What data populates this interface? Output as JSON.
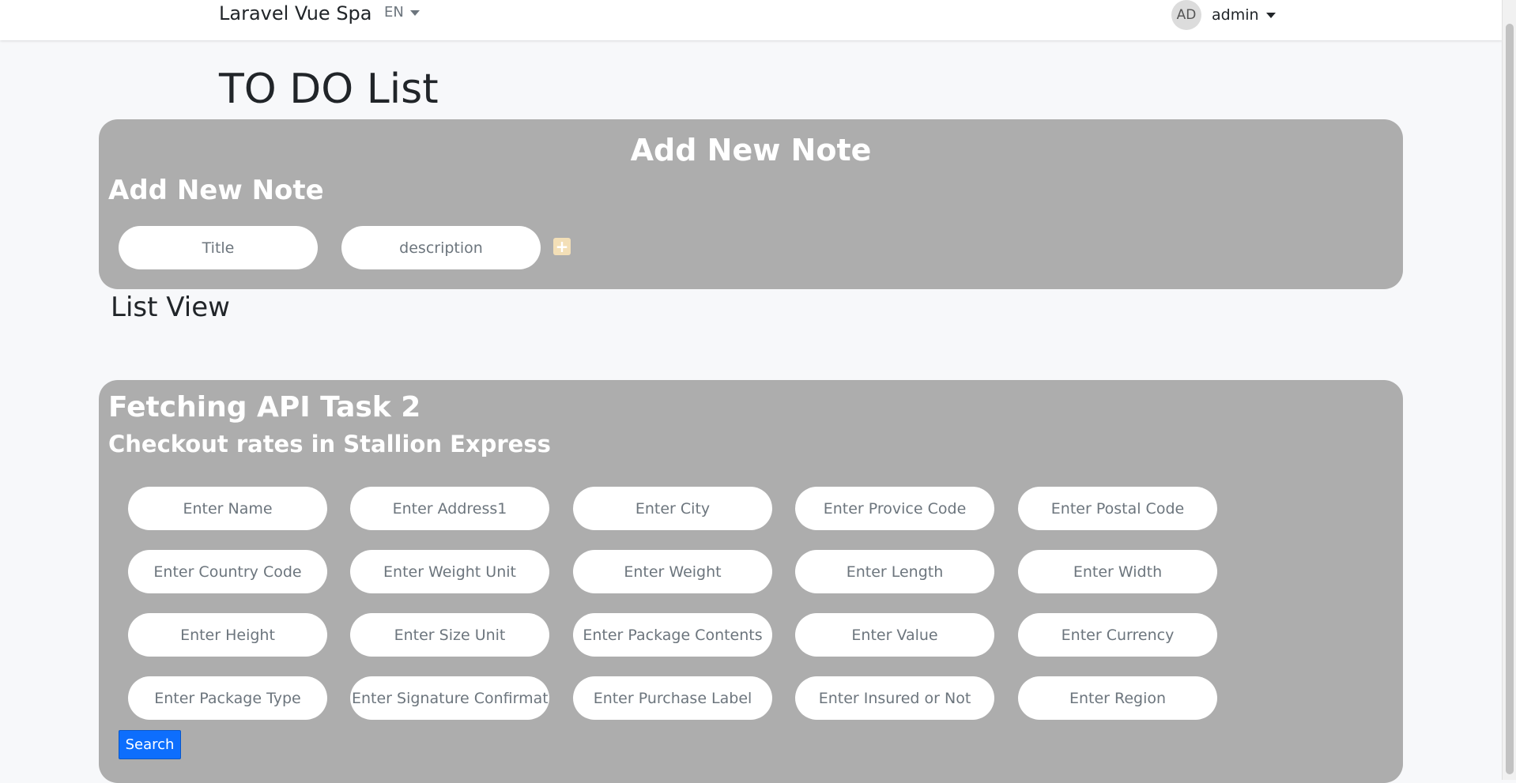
{
  "navbar": {
    "brand": "Laravel Vue Spa",
    "language": "EN",
    "user": {
      "initials": "AD",
      "name": "admin"
    }
  },
  "page": {
    "title": "TO DO List"
  },
  "add_note": {
    "heading_center": "Add New Note",
    "heading_left": "Add New Note",
    "title_placeholder": "Title",
    "description_placeholder": "description",
    "add_icon": "plus-square-icon"
  },
  "list_view": {
    "heading": "List View"
  },
  "api_task": {
    "title": "Fetching API Task 2",
    "subtitle": "Checkout rates in Stallion Express",
    "fields": [
      "Enter Name",
      "Enter Address1",
      "Enter City",
      "Enter Provice Code",
      "Enter Postal Code",
      "Enter Country Code",
      "Enter Weight Unit",
      "Enter Weight",
      "Enter Length",
      "Enter Width",
      "Enter Height",
      "Enter Size Unit",
      "Enter Package Contents",
      "Enter Value",
      "Enter Currency",
      "Enter Package Type",
      "Enter Signature Confirmation",
      "Enter Purchase Label",
      "Enter Insured or Not",
      "Enter Region"
    ],
    "search_label": "Search"
  },
  "colors": {
    "panel_bg": "#adadad",
    "page_bg": "#f7f8fa",
    "button_primary": "#0d6efd",
    "add_icon_bg": "#f3dfb7"
  }
}
